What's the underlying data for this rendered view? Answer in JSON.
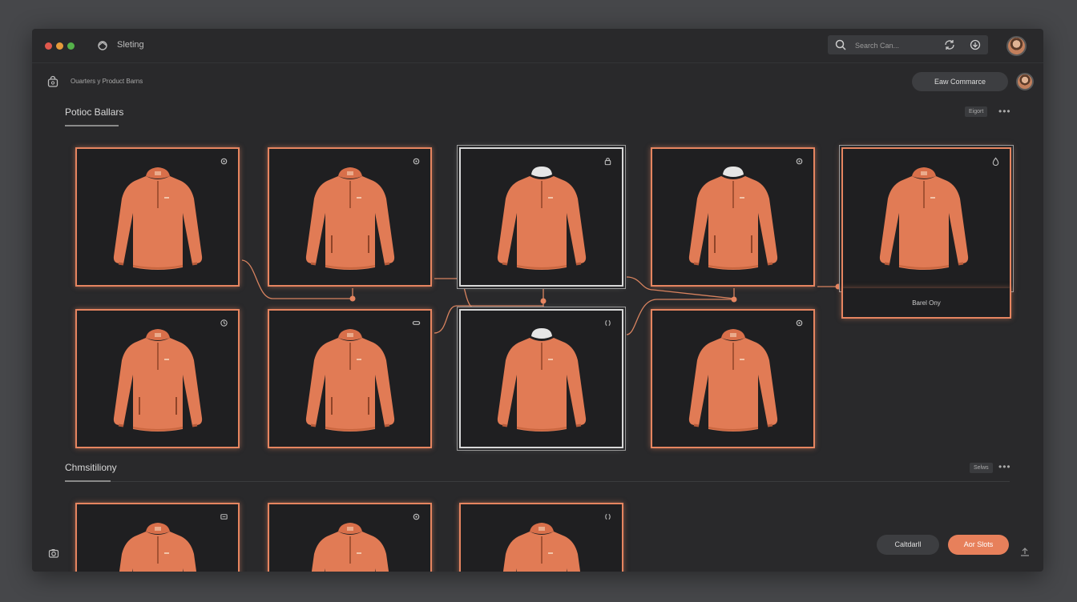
{
  "window": {
    "title": "Sleting"
  },
  "search": {
    "placeholder": "Search Can..."
  },
  "breadcrumb": "Ouarters y Product Barns",
  "header_button": "Eaw Commarce",
  "section1": {
    "title": "Potioc Ballars",
    "tag": "Eigort"
  },
  "section2": {
    "title": "Chmsitiliony",
    "tag": "Selws"
  },
  "selected_label": "Barel Ony",
  "footer": {
    "secondary_button": "Caltdarll",
    "primary_button": "Aor Slots"
  },
  "colors": {
    "accent": "#e68560",
    "shirt": "#e17b55",
    "background": "#29292b"
  },
  "icons": {
    "top_cards": [
      "gear-icon",
      "gear-icon",
      "lock-icon",
      "gear-icon",
      "drop-icon"
    ],
    "bottom_cards": [
      "clock-icon",
      "link-icon",
      "parens-icon",
      "gear-icon"
    ],
    "third_row": [
      "tag-icon",
      "gear-icon",
      "parens-icon"
    ]
  }
}
